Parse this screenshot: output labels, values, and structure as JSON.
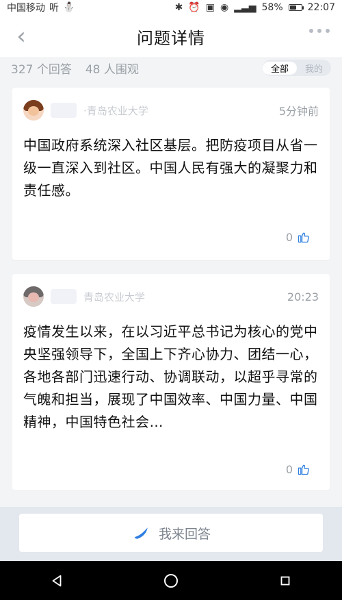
{
  "status_bar": {
    "carrier": "中国移动",
    "carrier_extra": "听",
    "battery": "58%",
    "time": "22:07",
    "battery_fraction": 0.58
  },
  "top_bar": {
    "title": "问题详情"
  },
  "stats": {
    "answers": "327 个回答",
    "viewers": "48 人围观",
    "filters": [
      {
        "label": "全部",
        "active": true
      },
      {
        "label": "我的",
        "active": false
      }
    ]
  },
  "answers": [
    {
      "school": "·青岛农业大学",
      "time": "5分钟前",
      "content": "中国政府系统深入社区基层。把防疫项目从省一级一直深入到社区。中国人民有强大的凝聚力和责任感。",
      "likes": "0",
      "avatar_style": "cartoon"
    },
    {
      "school": "青岛农业大学",
      "time": "20:23",
      "content": "疫情发生以来，在以习近平总书记为核心的党中央坚强领导下，全国上下齐心协力、团结一心，各地各部门迅速行动、协调联动，以超乎寻常的气魄和担当，展现了中国效率、中国力量、中国精神，中国特色社会…",
      "likes": "0",
      "avatar_style": "photo"
    }
  ],
  "answer_button": {
    "label": "我来回答"
  },
  "colors": {
    "accent": "#2f7fe0",
    "muted": "#9aa0a6",
    "background": "#f3f4f6",
    "navbar": "#000000"
  },
  "icons": {
    "back": "chevron-left-icon",
    "more": "more-horizontal-icon",
    "like": "thumbs-up-icon",
    "answer": "feather-icon",
    "nav_back": "triangle-back-icon",
    "nav_home": "circle-home-icon",
    "nav_recent": "square-recent-icon"
  }
}
